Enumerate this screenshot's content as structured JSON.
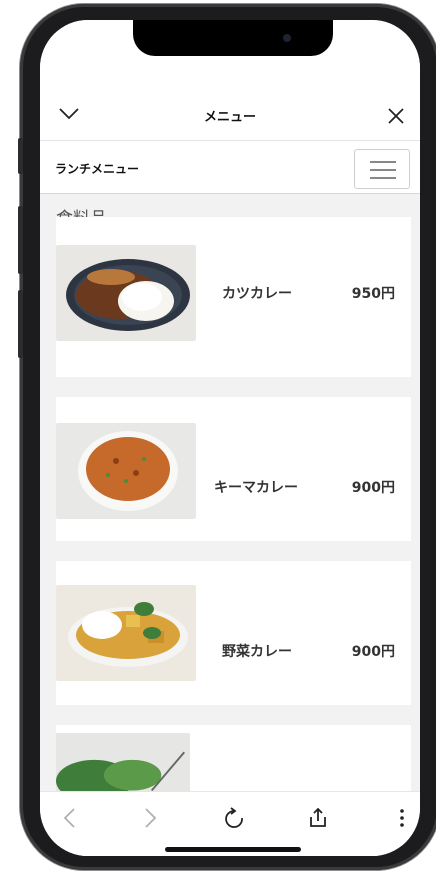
{
  "nav": {
    "title": "メニュー"
  },
  "subheader": {
    "title": "ランチメニュー"
  },
  "section": {
    "title": "食料品"
  },
  "items": [
    {
      "name": "カツカレー",
      "price": "950円"
    },
    {
      "name": "キーマカレー",
      "price": "900円"
    },
    {
      "name": "野菜カレー",
      "price": "900円"
    }
  ],
  "icons": {
    "collapse": "chevron-down-icon",
    "close": "close-icon",
    "menu": "hamburger-menu-icon",
    "back": "chevron-left-icon",
    "forward": "chevron-right-icon",
    "reload": "reload-icon",
    "share": "share-icon",
    "more": "more-vertical-icon"
  },
  "colors": {
    "background": "#f2f2f2",
    "card": "#ffffff",
    "text": "#333333"
  }
}
